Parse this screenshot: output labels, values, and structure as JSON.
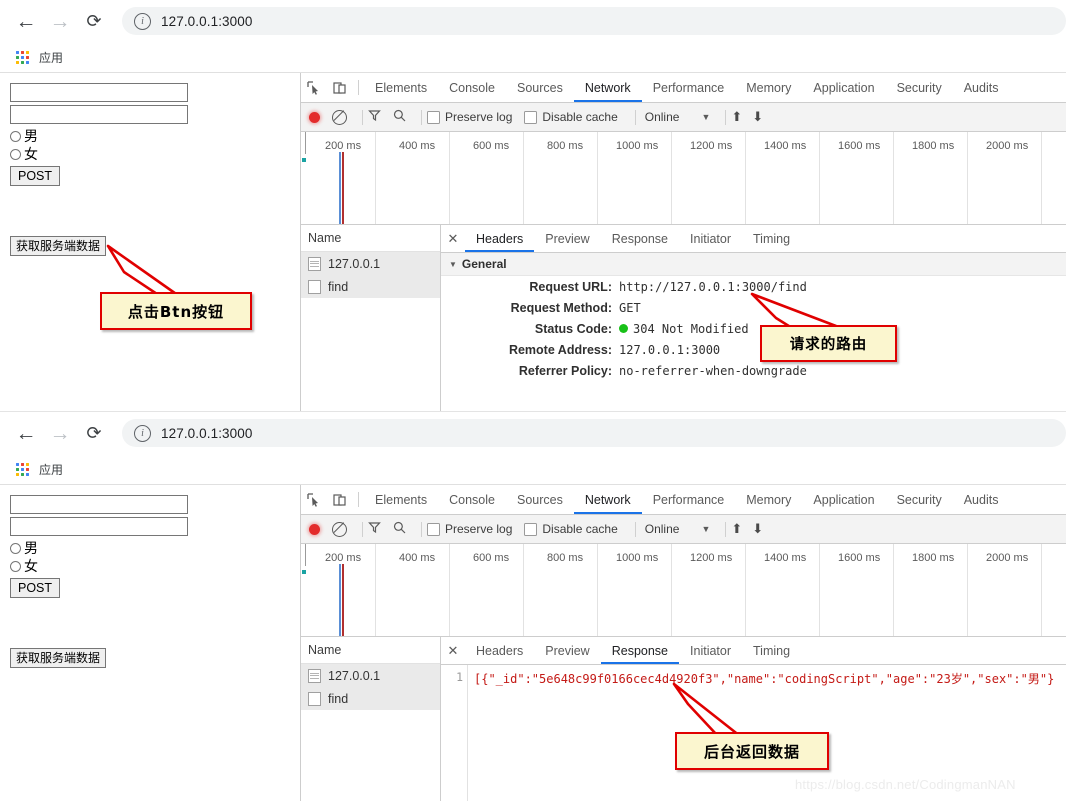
{
  "browser": {
    "back_icon": "back-arrow-icon",
    "forward_icon": "forward-arrow-icon",
    "reload_icon": "reload-icon",
    "info_icon": "info-circle-icon",
    "url": "127.0.0.1:3000",
    "bookmark_label": "应用"
  },
  "page_form": {
    "input1_value": "",
    "input2_value": "",
    "radio_male": "男",
    "radio_female": "女",
    "post_button": "POST",
    "fetch_button": "获取服务端数据"
  },
  "devtools": {
    "tabs": [
      "Elements",
      "Console",
      "Sources",
      "Network",
      "Performance",
      "Memory",
      "Application",
      "Security",
      "Audits"
    ],
    "active_tab": "Network",
    "inspect_icon": "inspect-cursor-icon",
    "device_icon": "device-toolbar-icon",
    "toolbar": {
      "record_icon": "record-dot-icon",
      "clear_icon": "clear-no-entry-icon",
      "filter_icon": "funnel-filter-icon",
      "search_icon": "search-magnifier-icon",
      "preserve_log": "Preserve log",
      "disable_cache": "Disable cache",
      "throttle_value": "Online",
      "caret_icon": "chevron-down-icon",
      "import_icon": "import-arrow-up-icon",
      "export_icon": "export-arrow-down-icon"
    },
    "timeline_ticks": [
      "200 ms",
      "400 ms",
      "600 ms",
      "800 ms",
      "1000 ms",
      "1200 ms",
      "1400 ms",
      "1600 ms",
      "1800 ms",
      "2000 ms"
    ],
    "requests_header": "Name",
    "requests": [
      {
        "name": "127.0.0.1",
        "icon": "document-icon"
      },
      {
        "name": "find",
        "icon": "blank-document-icon"
      }
    ],
    "detail_tabs": [
      "Headers",
      "Preview",
      "Response",
      "Initiator",
      "Timing"
    ],
    "close_icon": "close-x-icon"
  },
  "headers_panel": {
    "active_tab": "Headers",
    "section_title": "General",
    "disclosure_icon": "triangle-down-icon",
    "rows": [
      {
        "key": "Request URL:",
        "value": "http://127.0.0.1:3000/find"
      },
      {
        "key": "Request Method:",
        "value": "GET"
      },
      {
        "key": "Status Code:",
        "value": "304 Not Modified",
        "status_dot": "#19c119"
      },
      {
        "key": "Remote Address:",
        "value": "127.0.0.1:3000"
      },
      {
        "key": "Referrer Policy:",
        "value": "no-referrer-when-downgrade"
      }
    ]
  },
  "response_panel": {
    "active_tab": "Response",
    "line_number": "1",
    "body": "[{\"_id\":\"5e648c99f0166cec4d4920f3\",\"name\":\"codingScript\",\"age\":\"23岁\",\"sex\":\"男\"}"
  },
  "annotations": [
    {
      "id": "click-btn",
      "text": "点击Btn按钮"
    },
    {
      "id": "request-route",
      "text": "请求的路由"
    },
    {
      "id": "backend-data",
      "text": "后台返回数据"
    }
  ],
  "watermark": "https://blog.csdn.net/CodingmanNAN",
  "colors": {
    "accent": "#1a73e8",
    "record": "#e32b2b",
    "callout_bg": "#fbf6cf",
    "callout_border": "#e00000",
    "status_ok": "#19c119"
  }
}
